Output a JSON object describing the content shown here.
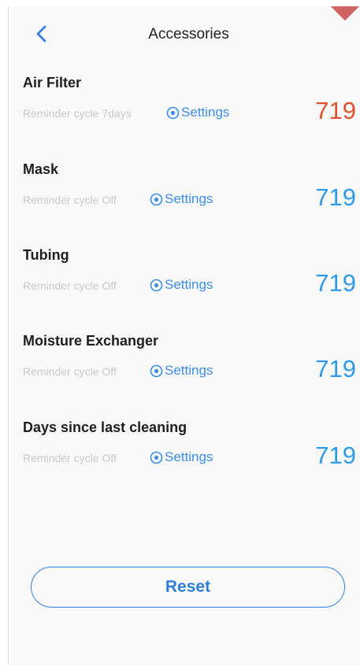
{
  "header": {
    "title": "Accessories",
    "back_icon": "chevron-left-icon"
  },
  "accessories": [
    {
      "name": "Air Filter",
      "reminder": "Reminder cycle 7days",
      "settings_label": "Settings",
      "count": "719",
      "alert": true
    },
    {
      "name": "Mask",
      "reminder": "Reminder cycle Off",
      "settings_label": "Settings",
      "count": "719",
      "alert": false
    },
    {
      "name": "Tubing",
      "reminder": "Reminder cycle Off",
      "settings_label": "Settings",
      "count": "719",
      "alert": false
    },
    {
      "name": "Moisture Exchanger",
      "reminder": "Reminder cycle Off",
      "settings_label": "Settings",
      "count": "719",
      "alert": false
    },
    {
      "name": "Days since last cleaning",
      "reminder": "Reminder cycle Off",
      "settings_label": "Settings",
      "count": "719",
      "alert": false
    }
  ],
  "settings_icon": "settings-icon",
  "reset_button": {
    "label": "Reset"
  },
  "colors": {
    "accent": "#2f7ed8",
    "count_normal": "#2f9be8",
    "count_alert": "#e0532f",
    "reminder_text": "#c8c8c8",
    "background": "#f9f9f9"
  }
}
